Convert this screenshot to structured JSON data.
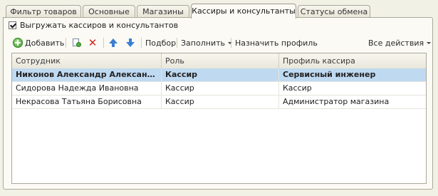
{
  "tabs": [
    {
      "label": "Фильтр товаров"
    },
    {
      "label": "Основные"
    },
    {
      "label": "Магазины"
    },
    {
      "label": "Кассиры и консультанты"
    },
    {
      "label": "Статусы обмена"
    }
  ],
  "active_tab": "Кассиры и консультанты",
  "export_checkbox": {
    "label": "Выгружать кассиров и консультантов",
    "checked": true
  },
  "toolbar": {
    "add_label": "Добавить",
    "pick_label": "Подбор",
    "fill_label": "Заполнить",
    "assign_profile_label": "Назначить профиль",
    "all_actions_label": "Все действия"
  },
  "table": {
    "columns": [
      "Сотрудник",
      "Роль",
      "Профиль кассира"
    ],
    "rows": [
      {
        "employee": "Никонов Александр Александрович",
        "role": "Кассир",
        "profile": "Сервисный инженер",
        "selected": true
      },
      {
        "employee": "Сидорова Надежда Ивановна",
        "role": "Кассир",
        "profile": "Кассир",
        "selected": false
      },
      {
        "employee": "Некрасова Татьяна Борисовна",
        "role": "Кассир",
        "profile": "Администратор магазина",
        "selected": false
      }
    ]
  },
  "colors": {
    "selection": "#bfd9f1",
    "background": "#f2f1e6",
    "accent_delete": "#d02a1e",
    "accent_arrows": "#3b7fd4"
  }
}
